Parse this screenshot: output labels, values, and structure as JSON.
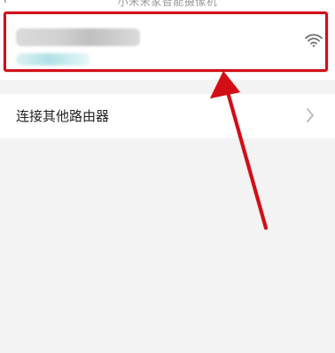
{
  "header": {
    "caption": "小米米家智能摄像机",
    "icon": "back-icon"
  },
  "wifi_network": {
    "name": "",
    "status": "",
    "signal_icon": "wifi-signal-icon"
  },
  "router_option": {
    "label": "连接其他路由器",
    "icon": "chevron-right-icon"
  },
  "annotation": {
    "type": "red-box-and-arrow",
    "color": "#d10f18"
  },
  "colors": {
    "background": "#f3f3f3",
    "card": "#ffffff",
    "text_primary": "#222222",
    "text_secondary": "#9a9a9a",
    "accent_red": "#d10f18"
  }
}
